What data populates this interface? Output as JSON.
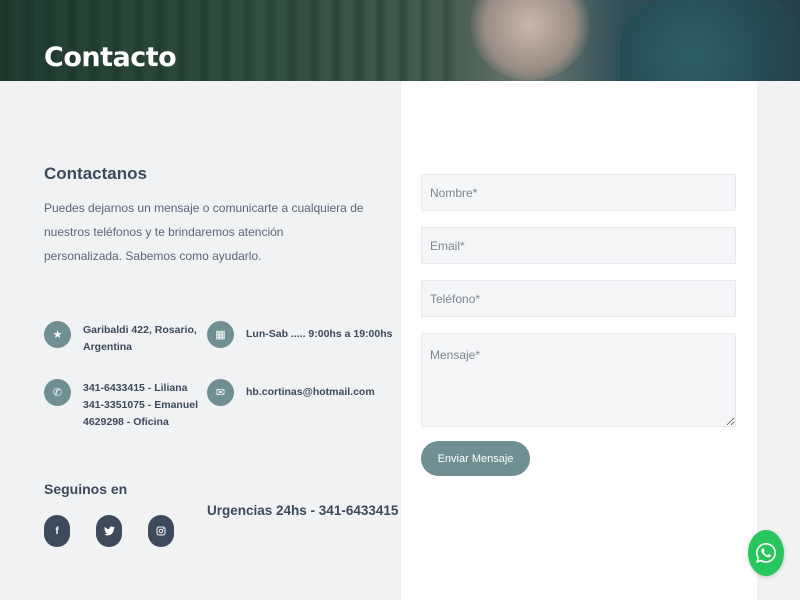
{
  "hero": {
    "title": "Contacto"
  },
  "contact": {
    "heading": "Contactanos",
    "description": "Puedes dejarnos un mensaje o comunicarte a cualquiera de nuestros teléfonos y te brindaremos atención personalizada. Sabemos como ayudarlo."
  },
  "info": {
    "address": [
      "Garibaldi 422, Rosario,",
      "Argentina"
    ],
    "hours": "Lun-Sab ..... 9:00hs a 19:00hs",
    "phones": [
      "341-6433415 - Liliana",
      "341-3351075 - Emanuel",
      "4629298 - Oficina"
    ],
    "email": "hb.cortinas@hotmail.com"
  },
  "social": {
    "heading": "Seguinos en",
    "networks": [
      {
        "name": "facebook",
        "icon": "f"
      },
      {
        "name": "twitter",
        "icon": "🐦"
      },
      {
        "name": "instagram",
        "icon": "◎"
      }
    ],
    "urgencias": "Urgencias 24hs - 341-6433415"
  },
  "form": {
    "nombre_placeholder": "Nombre*",
    "email_placeholder": "Email*",
    "telefono_placeholder": "Teléfono*",
    "mensaje_placeholder": "Mensaje*",
    "send_label": "Enviar Mensaje"
  },
  "colors": {
    "accent": "#6f8f93",
    "dark": "#3d4a5c",
    "whatsapp": "#29c55f"
  }
}
